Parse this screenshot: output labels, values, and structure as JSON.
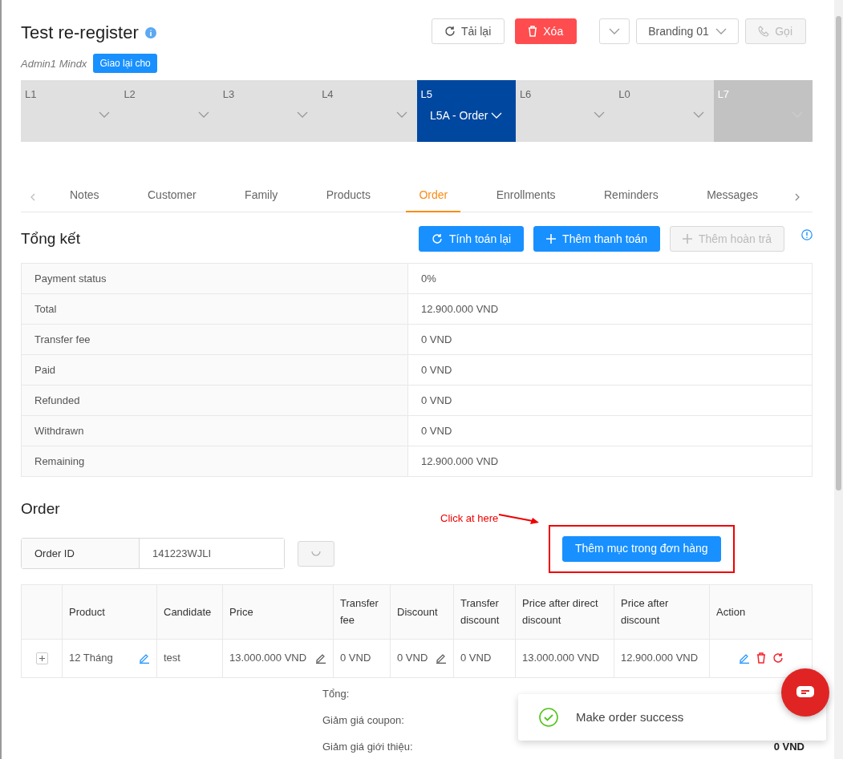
{
  "header": {
    "title": "Test re-register",
    "owner": "Admin1 Mindx",
    "assign_button": "Giao lại cho",
    "actions": [
      {
        "kind": "reload",
        "label": "Tải lại",
        "disabled": false
      },
      {
        "kind": "delete",
        "label": "Xóa",
        "disabled": false
      },
      {
        "kind": "dropdown"
      },
      {
        "kind": "select",
        "label": "Branding 01"
      },
      {
        "kind": "call",
        "label": "Gọi",
        "disabled": true
      }
    ]
  },
  "stages": [
    {
      "label": "L1",
      "selected": false,
      "disabled": false
    },
    {
      "label": "L2",
      "selected": false,
      "disabled": false
    },
    {
      "label": "L3",
      "selected": false,
      "disabled": false
    },
    {
      "label": "L4",
      "selected": false,
      "disabled": false
    },
    {
      "label": "L5",
      "value": "L5A - Order",
      "selected": true,
      "disabled": false
    },
    {
      "label": "L6",
      "selected": false,
      "disabled": false
    },
    {
      "label": "L0",
      "selected": false,
      "disabled": false
    },
    {
      "label": "L7",
      "selected": false,
      "disabled": true
    }
  ],
  "tabs": [
    {
      "label": "Notes",
      "selected": false
    },
    {
      "label": "Customer",
      "selected": false
    },
    {
      "label": "Family",
      "selected": false
    },
    {
      "label": "Products",
      "selected": false
    },
    {
      "label": "Order",
      "selected": true
    },
    {
      "label": "Enrollments",
      "selected": false
    },
    {
      "label": "Reminders",
      "selected": false
    },
    {
      "label": "Messages",
      "selected": false
    }
  ],
  "summary": {
    "title": "Tổng kết",
    "actions": [
      {
        "kind": "recalc",
        "label": "Tính toán lại",
        "disabled": false
      },
      {
        "kind": "add",
        "label": "Thêm thanh toán",
        "disabled": false
      },
      {
        "kind": "add",
        "label": "Thêm hoàn trả",
        "disabled": true
      }
    ],
    "rows": [
      {
        "label": "Payment status",
        "value": "0%"
      },
      {
        "label": "Total",
        "value": "12.900.000 VND"
      },
      {
        "label": "Transfer fee",
        "value": "0 VND"
      },
      {
        "label": "Paid",
        "value": "0 VND"
      },
      {
        "label": "Refunded",
        "value": "0 VND"
      },
      {
        "label": "Withdrawn",
        "value": "0 VND"
      },
      {
        "label": "Remaining",
        "value": "12.900.000 VND"
      }
    ]
  },
  "order": {
    "title": "Order",
    "id_label": "Order ID",
    "id_value": "141223WJLI",
    "annotation": "Click at here",
    "add_item_button": "Thêm mục trong đơn hàng",
    "columns": [
      "Product",
      "Candidate",
      "Price",
      "Transfer fee",
      "Discount",
      "Transfer discount",
      "Price after direct discount",
      "Price after discount",
      "Action"
    ],
    "rows": [
      {
        "cells": [
          {
            "text": "12 Tháng",
            "editable": true,
            "edit_highlighted": true
          },
          {
            "text": "test"
          },
          {
            "text": "13.000.000 VND",
            "editable": true,
            "edit_highlighted": false
          },
          {
            "text": "0 VND"
          },
          {
            "text": "0 VND",
            "editable": true,
            "edit_highlighted": false
          },
          {
            "text": "0 VND"
          },
          {
            "text": "13.000.000 VND"
          },
          {
            "text": "12.900.000 VND"
          }
        ]
      }
    ],
    "totals": [
      {
        "label": "Tổng:"
      },
      {
        "label": "Giảm giá coupon:"
      },
      {
        "label": "Giảm giá giới thiệu:",
        "value": "0 VND"
      }
    ]
  },
  "toast": {
    "kind": "success",
    "message": "Make order success"
  }
}
